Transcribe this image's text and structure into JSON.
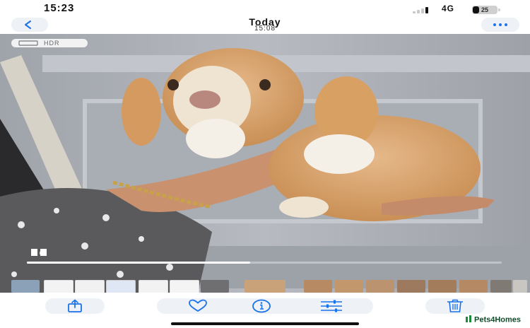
{
  "status_bar": {
    "time": "15:23",
    "network": "4G",
    "battery_level": "25",
    "battery_fraction": 0.25
  },
  "nav": {
    "title": "Today",
    "subtitle": "15:08",
    "back_icon": "chevron-left-icon",
    "more_icon": "ellipsis-icon"
  },
  "media": {
    "hdr_label": "HDR",
    "playback_progress": 0.47
  },
  "filmstrip": {
    "count": 16
  },
  "toolbar": {
    "share_icon": "share-icon",
    "favorite_icon": "heart-icon",
    "info_icon": "info-icon",
    "adjust_icon": "sliders-icon",
    "delete_icon": "trash-icon"
  },
  "watermark": {
    "text": "Pets4Homes"
  },
  "colors": {
    "accent": "#1a73e8",
    "pill": "#eef1f6",
    "watermark": "#0f4d2b"
  }
}
